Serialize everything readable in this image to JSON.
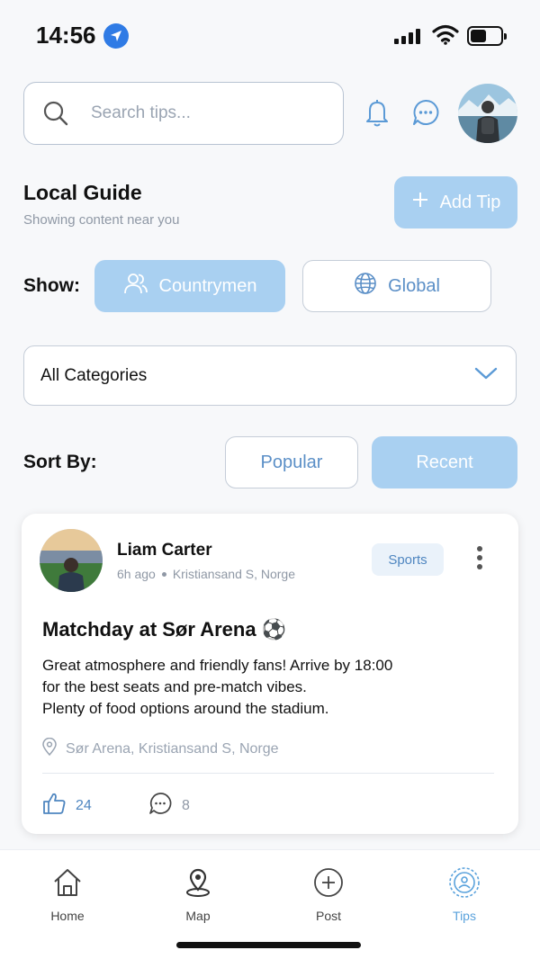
{
  "status_bar": {
    "time": "14:56"
  },
  "search": {
    "placeholder": "Search tips..."
  },
  "header": {
    "title": "Local Guide",
    "subtitle": "Showing content near you",
    "add_tip_label": "Add Tip"
  },
  "filters": {
    "show_label": "Show:",
    "countrymen_label": "Countrymen",
    "global_label": "Global",
    "selected_show": "Countrymen",
    "category_selected": "All Categories",
    "sort_label": "Sort By:",
    "popular_label": "Popular",
    "recent_label": "Recent",
    "selected_sort": "Recent"
  },
  "tip_card": {
    "author": "Liam Carter",
    "time_ago": "6h ago",
    "author_location": "Kristiansand S, Norge",
    "category": "Sports",
    "title": "Matchday at Sør Arena ⚽",
    "body_lines": [
      "Great atmosphere and friendly fans! Arrive by 18:00",
      "for the best seats and pre-match vibes.",
      "Plenty of food options around the stadium."
    ],
    "location": "Sør Arena, Kristiansand S, Norge",
    "likes": "24",
    "comments": "8"
  },
  "bottom_nav": {
    "items": [
      {
        "label": "Home",
        "icon": "home-icon"
      },
      {
        "label": "Map",
        "icon": "map-pin-icon"
      },
      {
        "label": "Post",
        "icon": "plus-circle-icon"
      },
      {
        "label": "Tips",
        "icon": "tips-icon"
      }
    ],
    "active": "Tips"
  },
  "colors": {
    "accent": "#a9d0f1",
    "accent_text": "#5b8fc7",
    "active_nav": "#5aa2dc"
  }
}
